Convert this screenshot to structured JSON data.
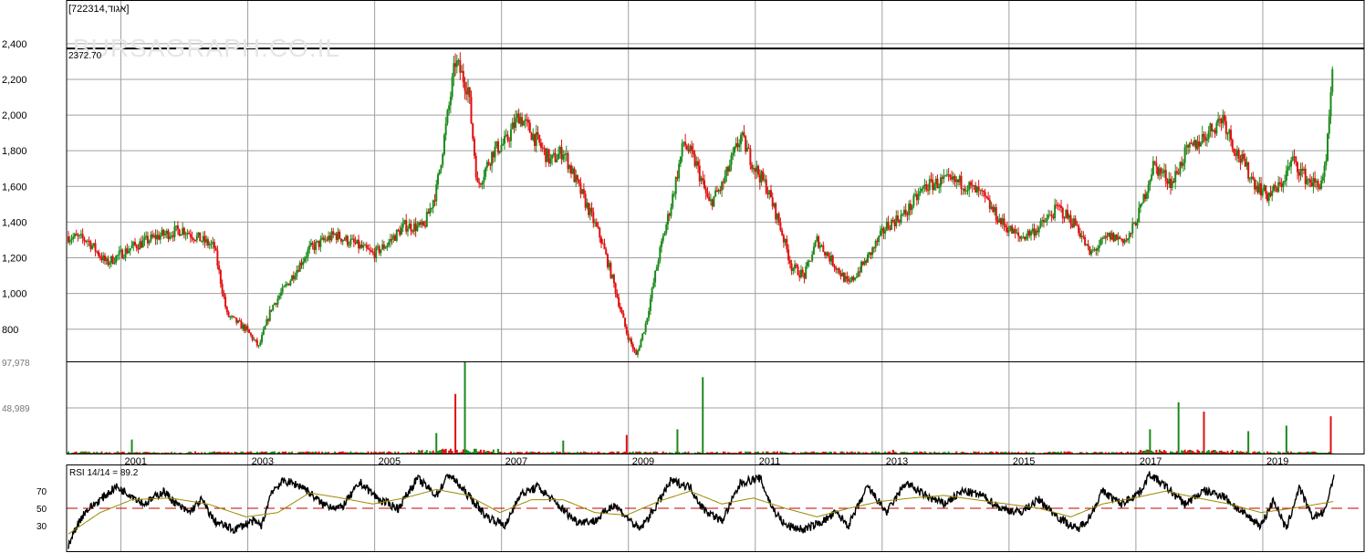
{
  "header": {
    "symbol": "[722314,אגוד]"
  },
  "watermark": "BURSAGRAPH.CO.IL",
  "colors": {
    "up": "#1b8a1b",
    "down": "#e01010",
    "rsi": "#000000",
    "rsi_signal": "#9a8a00",
    "ref_line": "#c00000"
  },
  "chart_data": [
    {
      "type": "candlestick",
      "panel": "price",
      "x_tick_labels": [
        "2001",
        "2003",
        "2005",
        "2007",
        "2009",
        "2011",
        "2013",
        "2015",
        "2017",
        "2019"
      ],
      "x_range": [
        2000.0,
        2019.95
      ],
      "ylim": [
        620,
        2440
      ],
      "y_ticks": [
        800,
        1000,
        1200,
        1400,
        1600,
        1800,
        2000,
        2200,
        2400
      ],
      "y_tick_labels": [
        "800",
        "1,000",
        "1,200",
        "1,400",
        "1,600",
        "1,800",
        "2,000",
        "2,200",
        "2,400"
      ],
      "max_marker": {
        "value": 2372.7,
        "label": "2372.70"
      },
      "series": [
        {
          "x": [
            2000.0,
            2000.3,
            2000.6,
            2001.0,
            2001.4,
            2001.8,
            2002.1,
            2002.3,
            2002.5,
            2002.8,
            2003.0,
            2003.2,
            2003.5,
            2003.8,
            2004.2,
            2004.5,
            2004.8,
            2005.0,
            2005.3,
            2005.6,
            2005.8,
            2006.0,
            2006.1,
            2006.3,
            2006.45,
            2006.7,
            2006.9,
            2007.1,
            2007.3,
            2007.6,
            2007.8,
            2008.0,
            2008.2,
            2008.4,
            2008.6,
            2008.8,
            2008.95,
            2009.1,
            2009.3,
            2009.5,
            2009.7,
            2009.9,
            2010.1,
            2010.3,
            2010.6,
            2010.8,
            2011.0,
            2011.2,
            2011.4,
            2011.6,
            2011.8,
            2012.0,
            2012.3,
            2012.6,
            2012.9,
            2013.2,
            2013.5,
            2013.8,
            2014.1,
            2014.4,
            2014.7,
            2015.0,
            2015.3,
            2015.6,
            2015.9,
            2016.1,
            2016.4,
            2016.7,
            2016.9,
            2017.1,
            2017.4,
            2017.6,
            2017.9,
            2018.2,
            2018.4,
            2018.7,
            2018.9,
            2019.1,
            2019.3,
            2019.5,
            2019.7,
            2019.82,
            2019.9,
            2019.95
          ],
          "values": [
            1320,
            1300,
            1170,
            1260,
            1320,
            1360,
            1300,
            1260,
            880,
            800,
            700,
            920,
            1080,
            1250,
            1330,
            1280,
            1220,
            1270,
            1380,
            1370,
            1580,
            2050,
            2300,
            2150,
            1600,
            1800,
            1850,
            2000,
            1900,
            1740,
            1800,
            1630,
            1470,
            1300,
            1050,
            780,
            650,
            830,
            1200,
            1500,
            1850,
            1720,
            1500,
            1600,
            1880,
            1720,
            1600,
            1400,
            1150,
            1100,
            1300,
            1200,
            1050,
            1200,
            1380,
            1450,
            1600,
            1630,
            1620,
            1550,
            1400,
            1310,
            1370,
            1480,
            1380,
            1220,
            1320,
            1300,
            1470,
            1720,
            1620,
            1780,
            1880,
            1990,
            1800,
            1620,
            1550,
            1600,
            1750,
            1650,
            1600,
            1700,
            2100,
            2372.7
          ]
        }
      ]
    },
    {
      "type": "bar",
      "panel": "volume",
      "y_ticks": [
        48989,
        97978
      ],
      "y_tick_labels": [
        "48,989",
        "97,978"
      ],
      "ylim": [
        0,
        97978
      ],
      "spikes": {
        "x": [
          2001.0,
          2005.8,
          2006.1,
          2006.25,
          2007.8,
          2008.8,
          2009.6,
          2010.0,
          2013.0,
          2017.05,
          2017.5,
          2017.9,
          2018.6,
          2019.2,
          2019.9
        ],
        "values": [
          15000,
          22000,
          64000,
          97978,
          14000,
          20000,
          26000,
          82000,
          4000,
          26000,
          55000,
          45000,
          24000,
          30000,
          40000
        ]
      }
    },
    {
      "type": "line",
      "panel": "rsi",
      "label": "RSI 14/14 = 89.2",
      "y_ticks": [
        30,
        50,
        70
      ],
      "y_tick_labels": [
        "30",
        "50",
        "70"
      ],
      "ylim": [
        0,
        100
      ],
      "ref_value": 50,
      "last_value": 89.2,
      "series": [
        {
          "x": [
            2000.0,
            2000.1,
            2000.25,
            2000.5,
            2000.75,
            2001.0,
            2001.2,
            2001.5,
            2001.7,
            2001.9,
            2002.1,
            2002.3,
            2002.6,
            2002.9,
            2003.05,
            2003.2,
            2003.4,
            2003.7,
            2004.0,
            2004.3,
            2004.6,
            2004.9,
            2005.2,
            2005.5,
            2005.8,
            2006.0,
            2006.3,
            2006.6,
            2006.9,
            2007.1,
            2007.4,
            2007.7,
            2008.0,
            2008.3,
            2008.6,
            2008.8,
            2009.0,
            2009.2,
            2009.5,
            2009.8,
            2010.0,
            2010.3,
            2010.6,
            2010.9,
            2011.1,
            2011.3,
            2011.6,
            2011.9,
            2012.1,
            2012.3,
            2012.6,
            2012.9,
            2013.2,
            2013.5,
            2013.8,
            2014.1,
            2014.4,
            2014.7,
            2015.0,
            2015.3,
            2015.6,
            2015.9,
            2016.1,
            2016.3,
            2016.6,
            2016.9,
            2017.05,
            2017.3,
            2017.6,
            2017.9,
            2018.2,
            2018.5,
            2018.8,
            2019.0,
            2019.2,
            2019.4,
            2019.6,
            2019.8,
            2019.95
          ],
          "values": [
            5,
            25,
            45,
            60,
            75,
            65,
            55,
            70,
            55,
            45,
            60,
            35,
            25,
            35,
            30,
            70,
            82,
            75,
            55,
            50,
            80,
            60,
            50,
            85,
            65,
            90,
            65,
            40,
            30,
            65,
            75,
            55,
            35,
            35,
            55,
            40,
            25,
            45,
            82,
            75,
            50,
            35,
            80,
            85,
            50,
            30,
            25,
            35,
            45,
            30,
            75,
            45,
            80,
            65,
            55,
            70,
            65,
            50,
            45,
            60,
            40,
            25,
            40,
            70,
            55,
            70,
            90,
            75,
            55,
            70,
            65,
            45,
            30,
            60,
            25,
            75,
            40,
            45,
            89.2
          ]
        },
        {
          "x": [
            2000.0,
            2000.5,
            2001.0,
            2001.6,
            2002.2,
            2002.8,
            2003.3,
            2003.8,
            2004.3,
            2004.8,
            2005.3,
            2005.8,
            2006.3,
            2006.8,
            2007.3,
            2007.8,
            2008.3,
            2008.8,
            2009.3,
            2009.8,
            2010.3,
            2010.8,
            2011.3,
            2011.8,
            2012.3,
            2012.8,
            2013.3,
            2013.8,
            2014.3,
            2014.8,
            2015.3,
            2015.8,
            2016.3,
            2016.8,
            2017.3,
            2017.8,
            2018.3,
            2018.8,
            2019.3,
            2019.95
          ],
          "values": [
            20,
            45,
            60,
            62,
            55,
            40,
            45,
            68,
            62,
            55,
            62,
            72,
            65,
            45,
            60,
            60,
            45,
            42,
            58,
            70,
            55,
            62,
            50,
            40,
            50,
            58,
            62,
            65,
            60,
            55,
            50,
            40,
            55,
            62,
            70,
            62,
            55,
            45,
            50,
            58
          ]
        }
      ]
    }
  ]
}
